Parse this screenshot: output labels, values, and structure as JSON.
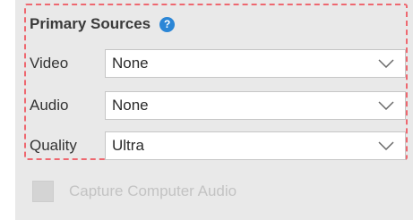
{
  "primary_sources": {
    "title": "Primary Sources",
    "help_glyph": "?",
    "rows": [
      {
        "label": "Video",
        "value": "None"
      },
      {
        "label": "Audio",
        "value": "None"
      },
      {
        "label": "Quality",
        "value": "Ultra"
      }
    ]
  },
  "capture_audio": {
    "label": "Capture Computer Audio",
    "checked": false,
    "enabled": false
  },
  "colors": {
    "panel_bg": "#e9e9e9",
    "highlight_border": "#ee6870",
    "help_icon": "#2b86d6",
    "disabled_text": "#c3c3c3"
  },
  "icons": [
    "help-icon",
    "chevron-down-icon"
  ]
}
